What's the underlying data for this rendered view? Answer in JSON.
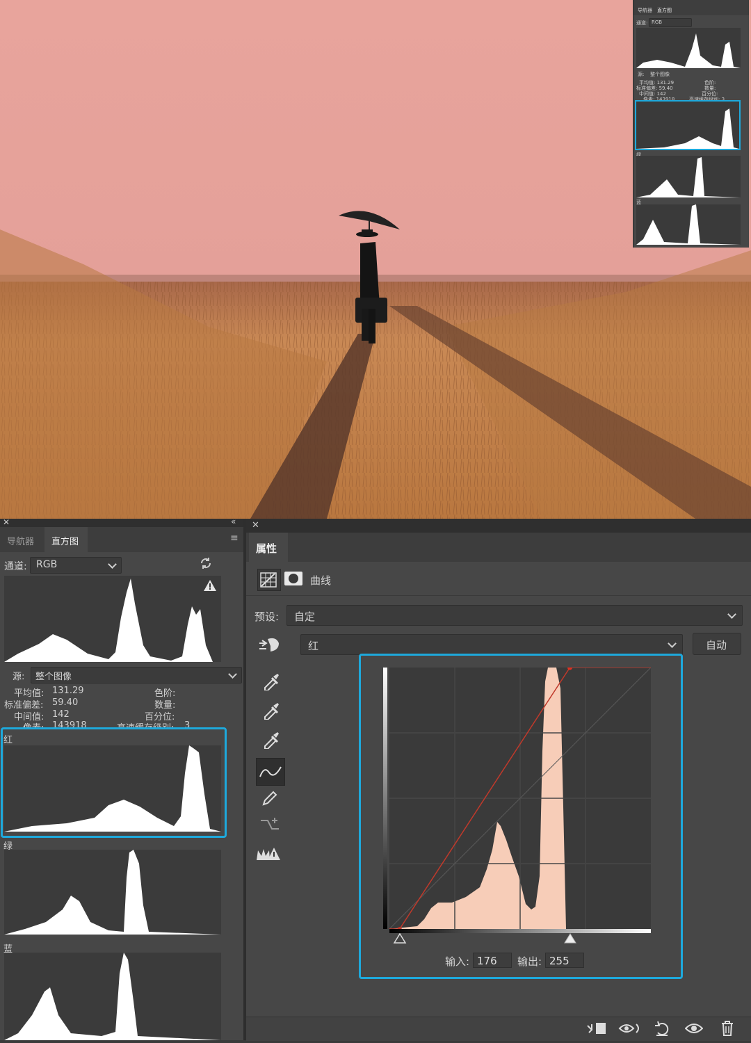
{
  "navigator_panel": {
    "tab_navigator": "导航器",
    "tab_histogram": "直方图",
    "channel_label": "通道:",
    "channel_value": "RGB",
    "source_label": "源:",
    "source_value": "整个图像",
    "stats": {
      "mean_label": "平均值:",
      "mean_value": "131.29",
      "stddev_label": "标准偏差:",
      "stddev_value": "59.40",
      "median_label": "中间值:",
      "median_value": "142",
      "pixels_label": "像素:",
      "pixels_value": "143918",
      "level_label": "色阶:",
      "count_label": "数量:",
      "percentile_label": "百分位:",
      "cache_label": "高速缓存级别:",
      "cache_value": "3"
    },
    "channels": {
      "red": "红",
      "green": "绿",
      "blue": "蓝"
    }
  },
  "properties_panel": {
    "tab_title": "属性",
    "adjustment_name": "曲线",
    "preset_label": "预设:",
    "preset_value": "自定",
    "channel_value": "红",
    "auto_button": "自动",
    "input_label": "输入:",
    "input_value": "176",
    "output_label": "输出:",
    "output_value": "255"
  },
  "mini_overlay": {
    "tab_navigator": "导航器",
    "tab_histogram": "直方图",
    "channel_label": "通道:",
    "channel_value": "RGB",
    "source_label": "源:",
    "source_value": "整个图像",
    "mean": "平均值: 131.29",
    "stddev": "标准偏差: 59.40",
    "median": "中间值: 142",
    "pixels": "像素: 143918",
    "level": "色阶:",
    "count": "数量:",
    "percentile": "百分位:",
    "cache": "高速缓存级别: 3",
    "red": "红",
    "green": "绿",
    "blue": "蓝"
  },
  "curve": {
    "points": [
      [
        10,
        0
      ],
      [
        176,
        255
      ]
    ],
    "black_slider": 10,
    "white_slider": 176
  },
  "colors": {
    "highlight": "#1ea9dc",
    "curve": "#c0392b",
    "histogram_fill": "#f7cdb8",
    "sky": "#e8a39a"
  },
  "icons": [
    "close-icon",
    "collapse-icon",
    "menu-icon",
    "refresh-icon",
    "warning-icon",
    "curves-grid-icon",
    "mask-icon",
    "targeted-adjust-icon",
    "eyedropper-black-icon",
    "eyedropper-gray-icon",
    "eyedropper-white-icon",
    "curve-point-tool-icon",
    "pencil-icon",
    "smooth-icon",
    "clipping-warning-icon",
    "clip-to-layer-icon",
    "view-previous-icon",
    "reset-icon",
    "visibility-icon",
    "trash-icon"
  ]
}
